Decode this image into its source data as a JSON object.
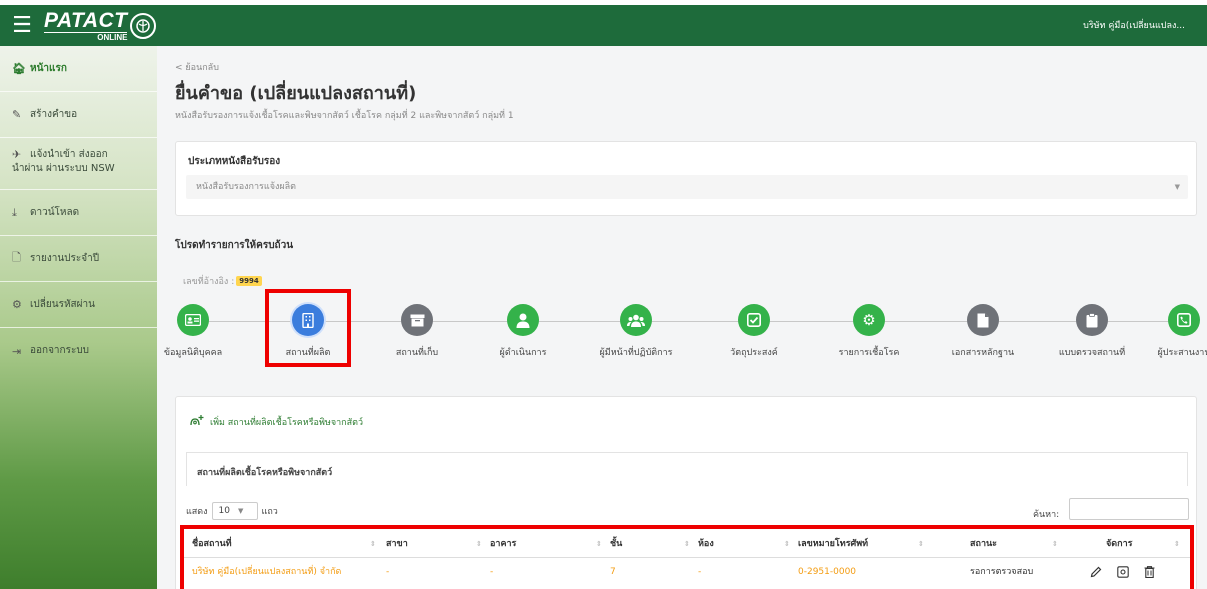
{
  "header": {
    "logo_main": "PATACT",
    "logo_sub": "ONLINE",
    "user": "บริษัท คู่มือ(เปลี่ยนแปลง..."
  },
  "sidebar": {
    "items": [
      {
        "label": "หน้าแรก",
        "icon": "home-icon"
      },
      {
        "label": "สร้างคำขอ",
        "icon": "pencil-icon"
      },
      {
        "label_line1": "แจ้งนำเข้า ส่งออก",
        "label_line2": "นำผ่าน ผ่านระบบ NSW",
        "icon": "plane-icon"
      },
      {
        "label": "ดาวน์โหลด",
        "icon": "download-icon"
      },
      {
        "label": "รายงานประจำปี",
        "icon": "file-icon"
      },
      {
        "label": "เปลี่ยนรหัสผ่าน",
        "icon": "cogs-icon"
      },
      {
        "label": "ออกจากระบบ",
        "icon": "logout-icon"
      }
    ]
  },
  "page": {
    "back": "< ย้อนกลับ",
    "title": "ยื่นคำขอ (เปลี่ยนแปลงสถานที่)",
    "subtitle": "หนังสือรับรองการแจ้งเชื้อโรคและพิษจากสัตว์ เชื้อโรค กลุ่มที่ 2 และพิษจากสัตว์ กลุ่มที่ 1",
    "cert_type_label": "ประเภทหนังสือรับรอง",
    "cert_type_value": "หนังสือรับรองการแจ้งผลิต",
    "fill_notice": "โปรดทำรายการให้ครบถ้วน",
    "ref_label": "เลขที่อ้างอิง :",
    "ref_value": "9994"
  },
  "steps": [
    {
      "label": "ข้อมูลนิติบุคคล",
      "color": "green",
      "icon": "id-card-icon"
    },
    {
      "label": "สถานที่ผลิต",
      "color": "blue",
      "icon": "building-icon"
    },
    {
      "label": "สถานที่เก็บ",
      "color": "gray",
      "icon": "archive-icon"
    },
    {
      "label": "ผู้ดำเนินการ",
      "color": "green",
      "icon": "user-icon"
    },
    {
      "label": "ผู้มีหน้าที่ปฏิบัติการ",
      "color": "green",
      "icon": "users-icon"
    },
    {
      "label": "วัตถุประสงค์",
      "color": "green",
      "icon": "check-square-icon"
    },
    {
      "label": "รายการเชื้อโรค",
      "color": "green",
      "icon": "gears-icon"
    },
    {
      "label": "เอกสารหลักฐาน",
      "color": "gray",
      "icon": "document-icon"
    },
    {
      "label": "แบบตรวจสถานที่",
      "color": "gray",
      "icon": "clipboard-icon"
    },
    {
      "label": "ผู้ประสานงาน",
      "color": "green",
      "icon": "phone-icon"
    }
  ],
  "table_card": {
    "add_label": "เพิ่ม สถานที่ผลิตเชื้อโรคหรือพิษจากสัตว์",
    "title": "สถานที่ผลิตเชื้อโรคหรือพิษจากสัตว์",
    "show_label": "แสดง",
    "page_size": "10",
    "rows_label": "แถว",
    "search_label": "ค้นหา:",
    "columns": [
      "ชื่อสถานที่",
      "สาขา",
      "อาคาร",
      "ชั้น",
      "ห้อง",
      "เลขหมายโทรศัพท์",
      "สถานะ",
      "จัดการ"
    ],
    "rows": [
      {
        "name": "บริษัท คู่มือ(เปลี่ยนแปลงสถานที่) จำกัด",
        "branch": "-",
        "building": "-",
        "floor": "7",
        "room": "-",
        "phone": "0-2951-0000",
        "status": "รอการตรวจสอบ"
      }
    ]
  },
  "colors": {
    "header": "#1e6b3b",
    "step_green": "#34b24a",
    "step_gray": "#6f7278",
    "step_active": "#3b7ddd",
    "highlight_red": "#ee0000",
    "link_orange": "#f39c12"
  }
}
